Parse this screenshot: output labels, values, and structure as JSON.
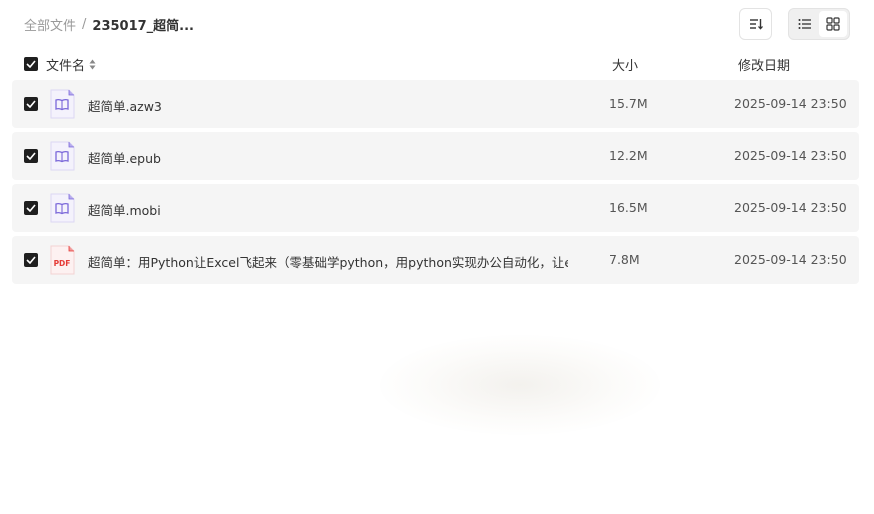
{
  "breadcrumb": {
    "root": "全部文件",
    "separator": "/",
    "current": "235017_超简..."
  },
  "toolbar": {
    "sort_icon": "sort-icon",
    "view_list_icon": "list-view-icon",
    "view_grid_icon": "grid-view-icon",
    "active_view": "grid"
  },
  "table": {
    "headers": {
      "name": "文件名",
      "size": "大小",
      "date": "修改日期"
    },
    "select_all_checked": true
  },
  "files": [
    {
      "name": "超简单.azw3",
      "size": "15.7M",
      "date": "2025-09-14 23:50",
      "type": "ebook",
      "checked": true
    },
    {
      "name": "超简单.epub",
      "size": "12.2M",
      "date": "2025-09-14 23:50",
      "type": "ebook",
      "checked": true
    },
    {
      "name": "超简单.mobi",
      "size": "16.5M",
      "date": "2025-09-14 23:50",
      "type": "ebook",
      "checked": true
    },
    {
      "name": "超简单：用Python让Excel飞起来（零基础学python，用python实现办公自动化，让ex...",
      "size": "7.8M",
      "date": "2025-09-14 23:50",
      "type": "pdf",
      "pdf_label": "PDF",
      "checked": true
    }
  ],
  "colors": {
    "ebook_accent": "#7b68d9",
    "pdf_accent": "#e53935",
    "row_bg": "#f5f5f5",
    "checkbox": "#1f1f1f"
  }
}
